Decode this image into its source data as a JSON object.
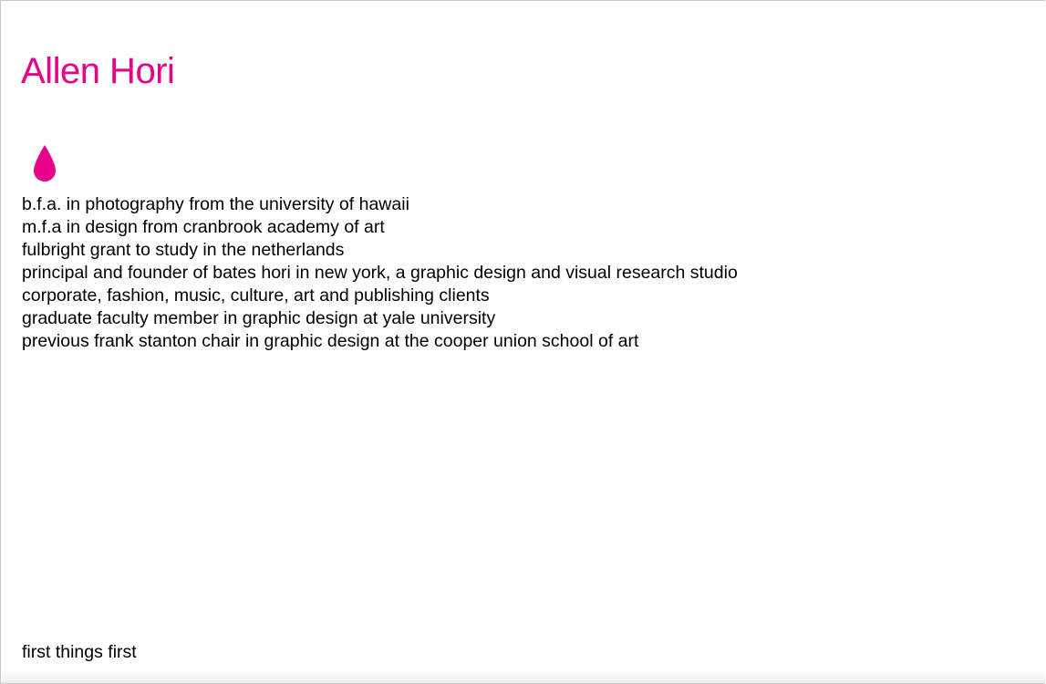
{
  "header": {
    "title": "Allen Hori"
  },
  "icon": {
    "name": "drop-icon",
    "color": "#e6008a"
  },
  "bio": {
    "lines": [
      "b.f.a. in photography from the university of hawaii",
      "m.f.a in design from cranbrook academy of art",
      "fulbright grant to study in the netherlands",
      "principal and founder of bates hori in new york, a graphic design and visual research studio",
      "corporate, fashion, music, culture, art and publishing clients",
      "graduate faculty member in graphic design at yale university",
      "previous frank stanton chair in graphic design at the cooper union school of art"
    ]
  },
  "footer": {
    "link_label": "first things first"
  },
  "colors": {
    "accent": "#e6008a",
    "text": "#000000",
    "background": "#ffffff"
  }
}
